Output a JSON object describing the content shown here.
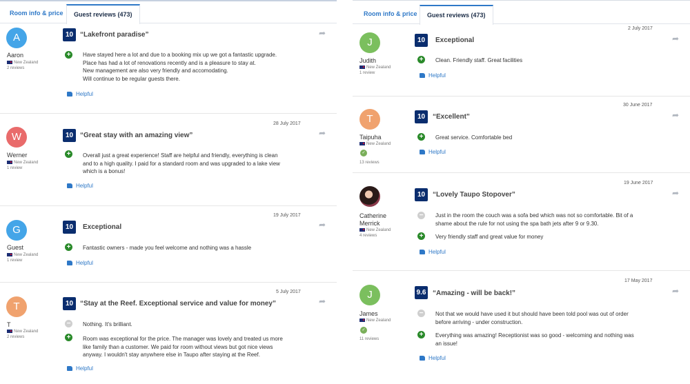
{
  "colors": {
    "accent": "#2e78c7",
    "score_bg": "#0a2d6e",
    "positive": "#2a8a2a",
    "negative": "#cfcfcf"
  },
  "left": {
    "tabs": {
      "room_info": "Room info & price",
      "guest_reviews": "Guest reviews (473)"
    },
    "reviews": [
      {
        "avatar": "A",
        "avatar_color": "#44a5e8",
        "name": "Aaron",
        "country": "New Zealand",
        "count": "2 reviews",
        "score": "10",
        "title": "“Lakefront paradise”",
        "date": "",
        "pos": "Have stayed here a lot and due to a booking mix up we got a fantastic upgrade.\nPlace has had a lot of renovations recently and is a pleasure to stay at.\nNew management are also very friendly and accomodating.\nWill continue to be regular guests there.",
        "helpful": "Helpful"
      },
      {
        "avatar": "W",
        "avatar_color": "#e96b6b",
        "name": "Werner",
        "country": "New Zealand",
        "count": "1 review",
        "score": "10",
        "title": "“Great stay with an amazing view”",
        "date": "28 July 2017",
        "pos": "Overall just a great experience! Staff are helpful and friendly, everything is clean\nand to a high quality. I paid for a standard room and was upgraded to a lake view\nwhich is a bonus!",
        "helpful": "Helpful"
      },
      {
        "avatar": "G",
        "avatar_color": "#44a5e8",
        "name": "Guest",
        "country": "New Zealand",
        "count": "1 review",
        "score": "10",
        "title": "Exceptional",
        "date": "19 July 2017",
        "pos": "Fantastic owners - made you feel welcome and nothing was a hassle",
        "helpful": "Helpful"
      },
      {
        "avatar": "T",
        "avatar_color": "#f0a26e",
        "name": "T",
        "country": "New Zealand",
        "count": "2 reviews",
        "score": "10",
        "title": "“Stay at the Reef. Exceptional service and value for money”",
        "date": "5 July 2017",
        "neg": "Nothing. It's brilliant.",
        "pos": "Room was exceptional for the price.  The manager was lovely and treated us more\nlike family than a customer. We paid for room without views but got nice views\nanyway. I wouldn't stay anywhere else in Taupo after staying at the Reef.",
        "helpful": "Helpful"
      }
    ]
  },
  "right": {
    "tabs": {
      "room_info": "Room info & price",
      "guest_reviews": "Guest reviews (473)"
    },
    "reviews": [
      {
        "avatar": "J",
        "avatar_color": "#7bbf5e",
        "name": "Judith",
        "country": "New Zealand",
        "count": "1 review",
        "score": "10",
        "title": "Exceptional",
        "date": "2 July 2017",
        "pos": "Clean. Friendly staff. Great facilities",
        "helpful": "Helpful"
      },
      {
        "avatar": "T",
        "avatar_color": "#f0a26e",
        "name": "Taipuha",
        "country": "New Zealand",
        "count": "13 reviews",
        "score": "10",
        "title": "“Excellent”",
        "date": "30 June 2017",
        "pos": "Great service. Comfortable bed",
        "helpful": "Helpful"
      },
      {
        "avatar": "",
        "avatar_color": "",
        "name": "Catherine\nMerrick",
        "country": "New Zealand",
        "count": "4 reviews",
        "score": "10",
        "title": "“Lovely Taupo Stopover”",
        "date": "19 June 2017",
        "neg": "Just in the room the couch was a sofa bed which was not so comfortable. Bit of a\nshame about the rule for not using the spa bath jets after 9 or 9.30.",
        "pos": "Very friendly staff and great value for money",
        "helpful": "Helpful"
      },
      {
        "avatar": "J",
        "avatar_color": "#7bbf5e",
        "name": "James",
        "country": "New Zealand",
        "count": "11 reviews",
        "score": "9.6",
        "title": "“Amazing - will be back!”",
        "date": "17 May 2017",
        "neg": "Not that we would have used it but should have been told pool was out of order\nbefore arriving - under construction.",
        "pos": "Everything was amazing! Receptionist was so good - welcoming and nothing was\nan issue!",
        "helpful": "Helpful"
      }
    ]
  }
}
